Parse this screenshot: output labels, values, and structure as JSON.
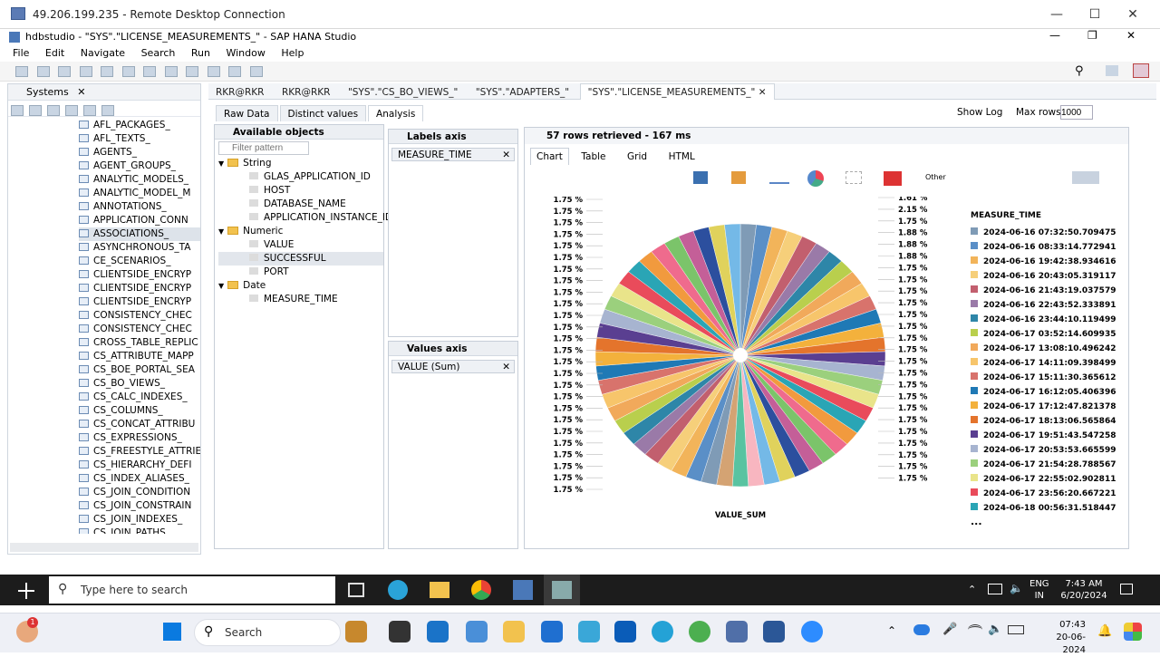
{
  "rdp": {
    "title": "49.206.199.235 - Remote Desktop Connection"
  },
  "app": {
    "title": "hdbstudio - \"SYS\".\"LICENSE_MEASUREMENTS_\" - SAP HANA Studio"
  },
  "menu": [
    "File",
    "Edit",
    "Navigate",
    "Search",
    "Run",
    "Window",
    "Help"
  ],
  "systems": {
    "title": "Systems",
    "items": [
      "AFL_PACKAGES_",
      "AFL_TEXTS_",
      "AGENTS_",
      "AGENT_GROUPS_",
      "ANALYTIC_MODELS_",
      "ANALYTIC_MODEL_M",
      "ANNOTATIONS_",
      "APPLICATION_CONN",
      "ASSOCIATIONS_",
      "ASYNCHRONOUS_TA",
      "CE_SCENARIOS_",
      "CLIENTSIDE_ENCRYP",
      "CLIENTSIDE_ENCRYP",
      "CLIENTSIDE_ENCRYP",
      "CONSISTENCY_CHEC",
      "CONSISTENCY_CHEC",
      "CROSS_TABLE_REPLIC",
      "CS_ATTRIBUTE_MAPP",
      "CS_BOE_PORTAL_SEA",
      "CS_BO_VIEWS_",
      "CS_CALC_INDEXES_",
      "CS_COLUMNS_",
      "CS_CONCAT_ATTRIBU",
      "CS_EXPRESSIONS_",
      "CS_FREESTYLE_ATTRIE",
      "CS_HIERARCHY_DEFI",
      "CS_INDEX_ALIASES_",
      "CS_JOIN_CONDITION",
      "CS_JOIN_CONSTRAIN",
      "CS_JOIN_INDEXES_",
      "CS_JOIN_PATHS_"
    ],
    "selected": "ASSOCIATIONS_"
  },
  "editor_tabs": [
    "RKR@RKR",
    "RKR@RKR",
    "\"SYS\".\"CS_BO_VIEWS_\"",
    "\"SYS\".\"ADAPTERS_\"",
    "\"SYS\".\"LICENSE_MEASUREMENTS_\""
  ],
  "subtabs": [
    "Raw Data",
    "Distinct values",
    "Analysis"
  ],
  "show_log": "Show Log",
  "max_rows_label": "Max rows:",
  "max_rows_value": "1000",
  "available": {
    "title": "Available objects",
    "filter_placeholder": "Filter pattern",
    "groups": [
      {
        "name": "String",
        "fields": [
          "GLAS_APPLICATION_ID",
          "HOST",
          "DATABASE_NAME",
          "APPLICATION_INSTANCE_ID"
        ]
      },
      {
        "name": "Numeric",
        "fields": [
          "VALUE",
          "SUCCESSFUL",
          "PORT"
        ]
      },
      {
        "name": "Date",
        "fields": [
          "MEASURE_TIME"
        ]
      }
    ]
  },
  "labels_axis": {
    "title": "Labels axis",
    "chip": "MEASURE_TIME"
  },
  "values_axis": {
    "title": "Values axis",
    "chip": "VALUE (Sum)"
  },
  "status": "57 rows retrieved - 167 ms",
  "view_tabs": [
    "Chart",
    "Table",
    "Grid",
    "HTML"
  ],
  "other_label": "Other",
  "chart_data": {
    "type": "pie",
    "xlabel": "VALUE_SUM",
    "legend_title": "MEASURE_TIME",
    "left_labels": [
      "1.75 %",
      "1.75 %",
      "1.75 %",
      "1.75 %",
      "1.75 %",
      "1.75 %",
      "1.75 %",
      "1.75 %",
      "1.75 %",
      "1.75 %",
      "1.75 %",
      "1.75 %",
      "1.75 %",
      "1.75 %",
      "1.75 %",
      "1.75 %",
      "1.75 %",
      "1.75 %",
      "1.75 %",
      "1.75 %",
      "1.75 %",
      "1.75 %",
      "1.75 %",
      "1.75 %",
      "1.75 %",
      "1.75 %"
    ],
    "right_labels": [
      "1.61 %",
      "2.15 %",
      "1.75 %",
      "1.88 %",
      "1.88 %",
      "1.88 %",
      "1.75 %",
      "1.75 %",
      "1.75 %",
      "1.75 %",
      "1.75 %",
      "1.75 %",
      "1.75 %",
      "1.75 %",
      "1.75 %",
      "1.75 %",
      "1.75 %",
      "1.75 %",
      "1.75 %",
      "1.75 %",
      "1.75 %",
      "1.75 %",
      "1.75 %",
      "1.75 %",
      "1.75 %"
    ],
    "legend": [
      "2024-06-16 07:32:50.709475",
      "2024-06-16 08:33:14.772941",
      "2024-06-16 19:42:38.934616",
      "2024-06-16 20:43:05.319117",
      "2024-06-16 21:43:19.037579",
      "2024-06-16 22:43:52.333891",
      "2024-06-16 23:44:10.119499",
      "2024-06-17 03:52:14.609935",
      "2024-06-17 13:08:10.496242",
      "2024-06-17 14:11:09.398499",
      "2024-06-17 15:11:30.365612",
      "2024-06-17 16:12:05.406396",
      "2024-06-17 17:12:47.821378",
      "2024-06-17 18:13:06.565864",
      "2024-06-17 19:51:43.547258",
      "2024-06-17 20:53:53.665599",
      "2024-06-17 21:54:28.788567",
      "2024-06-17 22:55:02.902811",
      "2024-06-17 23:56:20.667221",
      "2024-06-18 00:56:31.518447"
    ],
    "legend_more": "...",
    "colors": [
      "#7f9bb6",
      "#5a8fc7",
      "#f2b45a",
      "#f6cf7a",
      "#c25f6e",
      "#9a7aa8",
      "#2e86a8",
      "#b9cf4d",
      "#f1a95b",
      "#f7c56b",
      "#d8736c",
      "#1f79b5",
      "#f3b13c",
      "#e4742c",
      "#5a3f91",
      "#a7b4d0",
      "#9bd07d",
      "#e9e48a",
      "#e94b5b",
      "#2aa5b5",
      "#f19a3e",
      "#ef6b8d",
      "#7bc46a",
      "#c45f98",
      "#2c4f9e",
      "#e0d25c",
      "#74b9e7",
      "#f8b6c0",
      "#59c3a1",
      "#d4a373"
    ],
    "slices": 57
  },
  "taskbar1": {
    "search": "Type here to search",
    "lang1": "ENG",
    "lang2": "IN",
    "time": "7:43 AM",
    "date": "6/20/2024"
  },
  "taskbar2": {
    "search": "Search",
    "time": "07:43",
    "date": "20-06-2024",
    "badge": "1"
  }
}
